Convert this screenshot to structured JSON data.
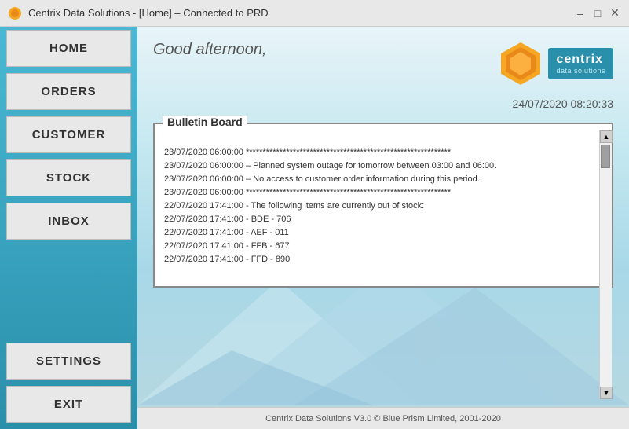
{
  "titlebar": {
    "title": "Centrix Data Solutions - [Home] – Connected to PRD",
    "minimize_label": "–",
    "maximize_label": "□",
    "close_label": "✕"
  },
  "sidebar": {
    "items": [
      {
        "id": "home",
        "label": "HOME"
      },
      {
        "id": "orders",
        "label": "ORDERS"
      },
      {
        "id": "customer",
        "label": "CUSTOMER"
      },
      {
        "id": "stock",
        "label": "STOCK"
      },
      {
        "id": "inbox",
        "label": "INBOX"
      },
      {
        "id": "settings",
        "label": "SETTINGS"
      },
      {
        "id": "exit",
        "label": "EXIT"
      }
    ]
  },
  "content": {
    "greeting": "Good afternoon,",
    "datetime": "24/07/2020 08:20:33",
    "logo": {
      "brand": "centrix",
      "sub": "data solutions"
    },
    "bulletin": {
      "title": "Bulletin Board",
      "lines": [
        "23/07/2020 06:00:00 *************************************************************",
        "23/07/2020 06:00:00 – Planned system outage for tomorrow between 03:00 and 06:00.",
        "23/07/2020 06:00:00 – No access to customer order information during this period.",
        "23/07/2020 06:00:00 *************************************************************",
        "",
        "22/07/2020 17:41:00 - The following items are currently out of stock:",
        "22/07/2020 17:41:00 - BDE - 706",
        "22/07/2020 17:41:00 - AEF - 011",
        "22/07/2020 17:41:00 - FFB - 677",
        "22/07/2020 17:41:00 - FFD - 890"
      ]
    }
  },
  "footer": {
    "text": "Centrix Data Solutions V3.0 © Blue Prism Limited, 2001-2020"
  }
}
